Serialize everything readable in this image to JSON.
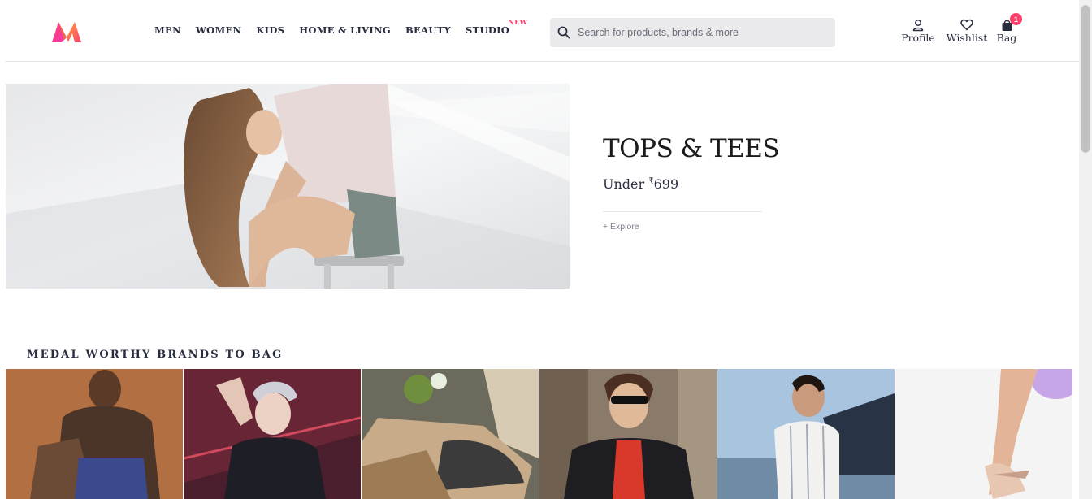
{
  "header": {
    "logo": "myntra-logo",
    "nav": [
      {
        "label": "MEN"
      },
      {
        "label": "WOMEN"
      },
      {
        "label": "KIDS"
      },
      {
        "label": "HOME & LIVING"
      },
      {
        "label": "BEAUTY"
      },
      {
        "label": "STUDIO",
        "tag": "NEW"
      }
    ],
    "search": {
      "placeholder": "Search for products, brands & more",
      "value": ""
    },
    "actions": {
      "profile": "Profile",
      "wishlist": "Wishlist",
      "bag": "Bag",
      "bag_count": "1"
    }
  },
  "hero": {
    "title": "TOPS & TEES",
    "subtitle_prefix": "Under ",
    "currency": "₹",
    "price": "699",
    "explore": "+ Explore"
  },
  "brands_section": {
    "title": "MEDAL WORTHY BRANDS TO BAG",
    "tiles": [
      {
        "name": "brand-tile-1"
      },
      {
        "name": "brand-tile-2"
      },
      {
        "name": "brand-tile-3"
      },
      {
        "name": "brand-tile-4"
      },
      {
        "name": "brand-tile-5"
      },
      {
        "name": "brand-tile-6"
      }
    ]
  },
  "colors": {
    "accent": "#ff3f6c",
    "text": "#282c3f",
    "search_bg": "#eaeaec"
  }
}
